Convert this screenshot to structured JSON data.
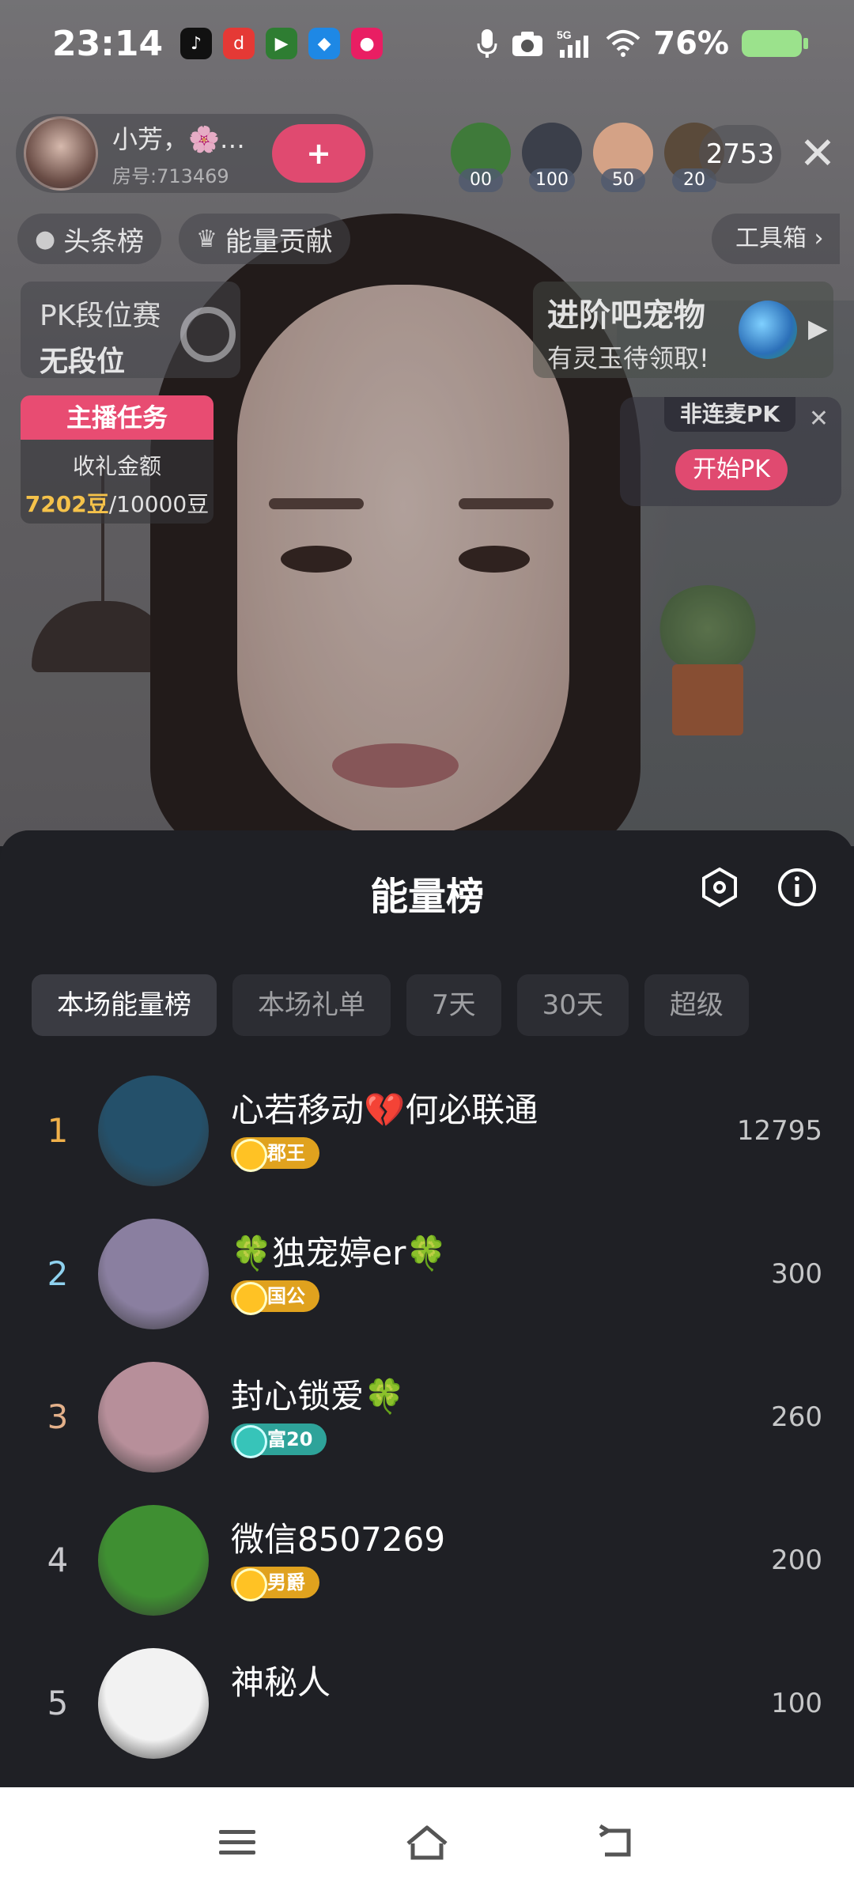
{
  "status_bar": {
    "time": "23:14",
    "battery": "76%",
    "apps": [
      {
        "icon": "tiktok-icon",
        "color": "#111111"
      },
      {
        "icon": "dou-app-icon",
        "color": "#e53935"
      },
      {
        "icon": "play-app-icon",
        "color": "#2e7d32"
      },
      {
        "icon": "blue-app-icon",
        "color": "#1e88e5"
      },
      {
        "icon": "pink-app-icon",
        "color": "#e91e63"
      }
    ]
  },
  "host": {
    "name": "小芳，🌸…",
    "room": "房号:713469",
    "follow_label": "+"
  },
  "viewers": [
    {
      "count": "00",
      "color": "#3f7a3a"
    },
    {
      "count": "100",
      "color": "#3b3f4a"
    },
    {
      "count": "50",
      "color": "#d4a286"
    },
    {
      "count": "20",
      "color": "#5a4a3a"
    }
  ],
  "viewer_total": "2753",
  "tags": {
    "headline": "头条榜",
    "energy": "能量贡献",
    "toolbox": "工具箱 ›"
  },
  "pk": {
    "title": "PK段位赛",
    "rank": "无段位"
  },
  "pet": {
    "title": "进阶吧宠物",
    "subtitle": "有灵玉待领取!"
  },
  "task": {
    "header": "主播任务",
    "label": "收礼金额",
    "current": "7202豆",
    "target": "/10000豆"
  },
  "non_pk": {
    "title": "非连麦PK",
    "button": "开始PK",
    "close": "✕"
  },
  "sheet": {
    "title": "能量榜",
    "tabs": [
      "本场能量榜",
      "本场礼单",
      "7天",
      "30天",
      "超级"
    ],
    "active_tab": 0
  },
  "ranking": [
    {
      "rank": "1",
      "name": "心若移动💔何必联通",
      "badge": "郡王",
      "score": "12795",
      "rank_color": "#f0b04a",
      "badge_color": "#e0a21e",
      "avatar_color": "#24506a"
    },
    {
      "rank": "2",
      "name": "🍀独宠婷er🍀",
      "badge": "国公",
      "score": "300",
      "rank_color": "#8fd2ef",
      "badge_color": "#e0a21e",
      "avatar_color": "#8a7fa0"
    },
    {
      "rank": "3",
      "name": "封心锁爱🍀",
      "badge": "富20",
      "score": "260",
      "rank_color": "#e3b08a",
      "badge_color": "#2ea39a",
      "avatar_color": "#b78f9a"
    },
    {
      "rank": "4",
      "name": "微信8507269",
      "badge": "男爵",
      "score": "200",
      "rank_color": "#c8c8cc",
      "badge_color": "#e0a21e",
      "avatar_color": "#3f8f32"
    },
    {
      "rank": "5",
      "name": "神秘人",
      "badge": "",
      "score": "100",
      "rank_color": "#c8c8cc",
      "badge_color": "",
      "avatar_color": "#f2f2f2"
    }
  ]
}
